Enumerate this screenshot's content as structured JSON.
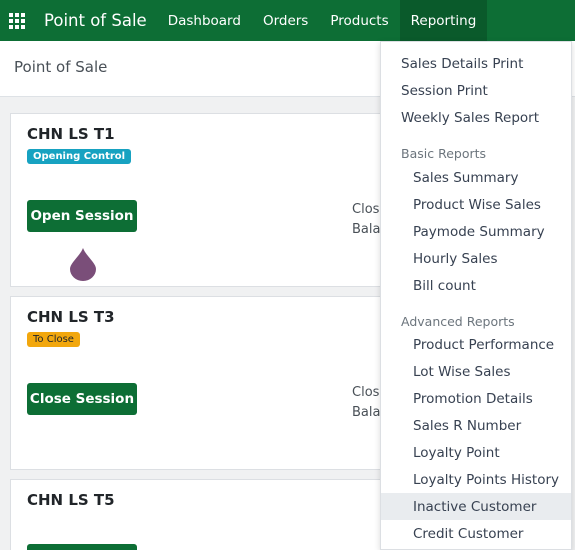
{
  "navbar": {
    "apps_icon": "grid-icon",
    "brand": "Point of Sale",
    "items": [
      "Dashboard",
      "Orders",
      "Products",
      "Reporting"
    ],
    "active_item": "Reporting"
  },
  "control_bar": {
    "title": "Point of Sale"
  },
  "sessions": [
    {
      "name": "CHN LS T1",
      "badge": "Opening Control",
      "button": "Open Session",
      "info_lines": [
        "Clos",
        "Bala"
      ]
    },
    {
      "name": "CHN LS T3",
      "badge": "To Close",
      "button": "Close Session",
      "info_lines": [
        "Clos",
        "Bala"
      ]
    },
    {
      "name": "CHN LS T5"
    }
  ],
  "drop_icon": "droplet-icon",
  "reporting_menu": {
    "top_items": [
      "Sales Details Print",
      "Session Print",
      "Weekly Sales Report"
    ],
    "sections": [
      {
        "header": "Basic Reports",
        "items": [
          "Sales Summary",
          "Product Wise Sales",
          "Paymode Summary",
          "Hourly Sales",
          "Bill count"
        ]
      },
      {
        "header": "Advanced Reports",
        "items": [
          "Product Performance",
          "Lot Wise Sales",
          "Promotion Details",
          "Sales R Number",
          "Loyalty Point",
          "Loyalty Points History",
          "Inactive Customer",
          "Credit Customer"
        ]
      }
    ],
    "highlighted_item": "Inactive Customer"
  },
  "colors": {
    "brand_green": "#0d6e35",
    "badge_info": "#17a2c1",
    "badge_warning": "#f2a70d",
    "drop_purple": "#7a4e79"
  }
}
